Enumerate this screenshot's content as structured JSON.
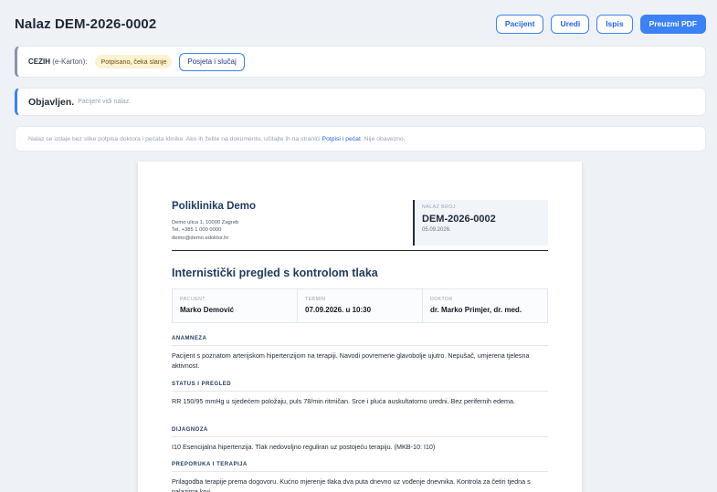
{
  "header": {
    "title": "Nalaz DEM-2026-0002",
    "buttons": {
      "patient": "Pacijent",
      "edit": "Uredi",
      "print": "Ispis",
      "download": "Preuzmi PDF"
    }
  },
  "cezih": {
    "label_bold": "CEZIH",
    "label_rest": " (e-Karton):",
    "status": "Potpisano, čeka slanje",
    "visit_button": "Posjeta i slučaj"
  },
  "published": {
    "title": "Objavljen.",
    "subtitle": "Pacijent vidi nalaz."
  },
  "notice": {
    "text_before": "Nalaz se izdaje bez slike potpisa doktora i pečata klinike. Ako ih želite na dokumentu, učitajte ih na stranici ",
    "link": "Potpisi i pečat",
    "text_after": ". Nije obavezno."
  },
  "document": {
    "clinic": {
      "name": "Poliklinika Demo",
      "address": "Demo ulica 1, 10000 Zagreb",
      "phone": "Tel. +385 1 000 0000",
      "email": "demo@demo.edoktor.hr"
    },
    "nalaz": {
      "label": "NALAZ BROJ",
      "number": "DEM-2026-0002",
      "date": "05.09.2026."
    },
    "title": "Internistički pregled s kontrolom tlaka",
    "meta": {
      "patient_label": "PACIJENT",
      "patient": "Marko Demović",
      "term_label": "TERMIN",
      "term": "07.09.2026. u 10:30",
      "doctor_label": "DOKTOR",
      "doctor": "dr. Marko Primjer, dr. med."
    },
    "sections": [
      {
        "title": "ANAMNEZA",
        "body": "Pacijent s poznatom arterijskom hipertenzijom na terapiji. Navodi povremene glavobolje ujutro. Nepušač, umjerena tjelesna aktivnost."
      },
      {
        "title": "STATUS I PREGLED",
        "body": "RR 150/95 mmHg u sjedećem položaju, puls 78/min ritmičan. Srce i pluća auskultatorno uredni. Bez perifernih edema."
      },
      {
        "title": "DIJAGNOZA",
        "body": "I10 Esencijalna hipertenzija. Tlak nedovoljno reguliran uz postojeću terapiju. (MKB-10: I10)"
      },
      {
        "title": "PREPORUKA I TERAPIJA",
        "body": "Prilagodba terapije prema dogovoru. Kućno mjerenje tlaka dva puta dnevno uz vođenje dnevnika. Kontrola za četiri tjedna s nalazima krvi."
      }
    ]
  }
}
